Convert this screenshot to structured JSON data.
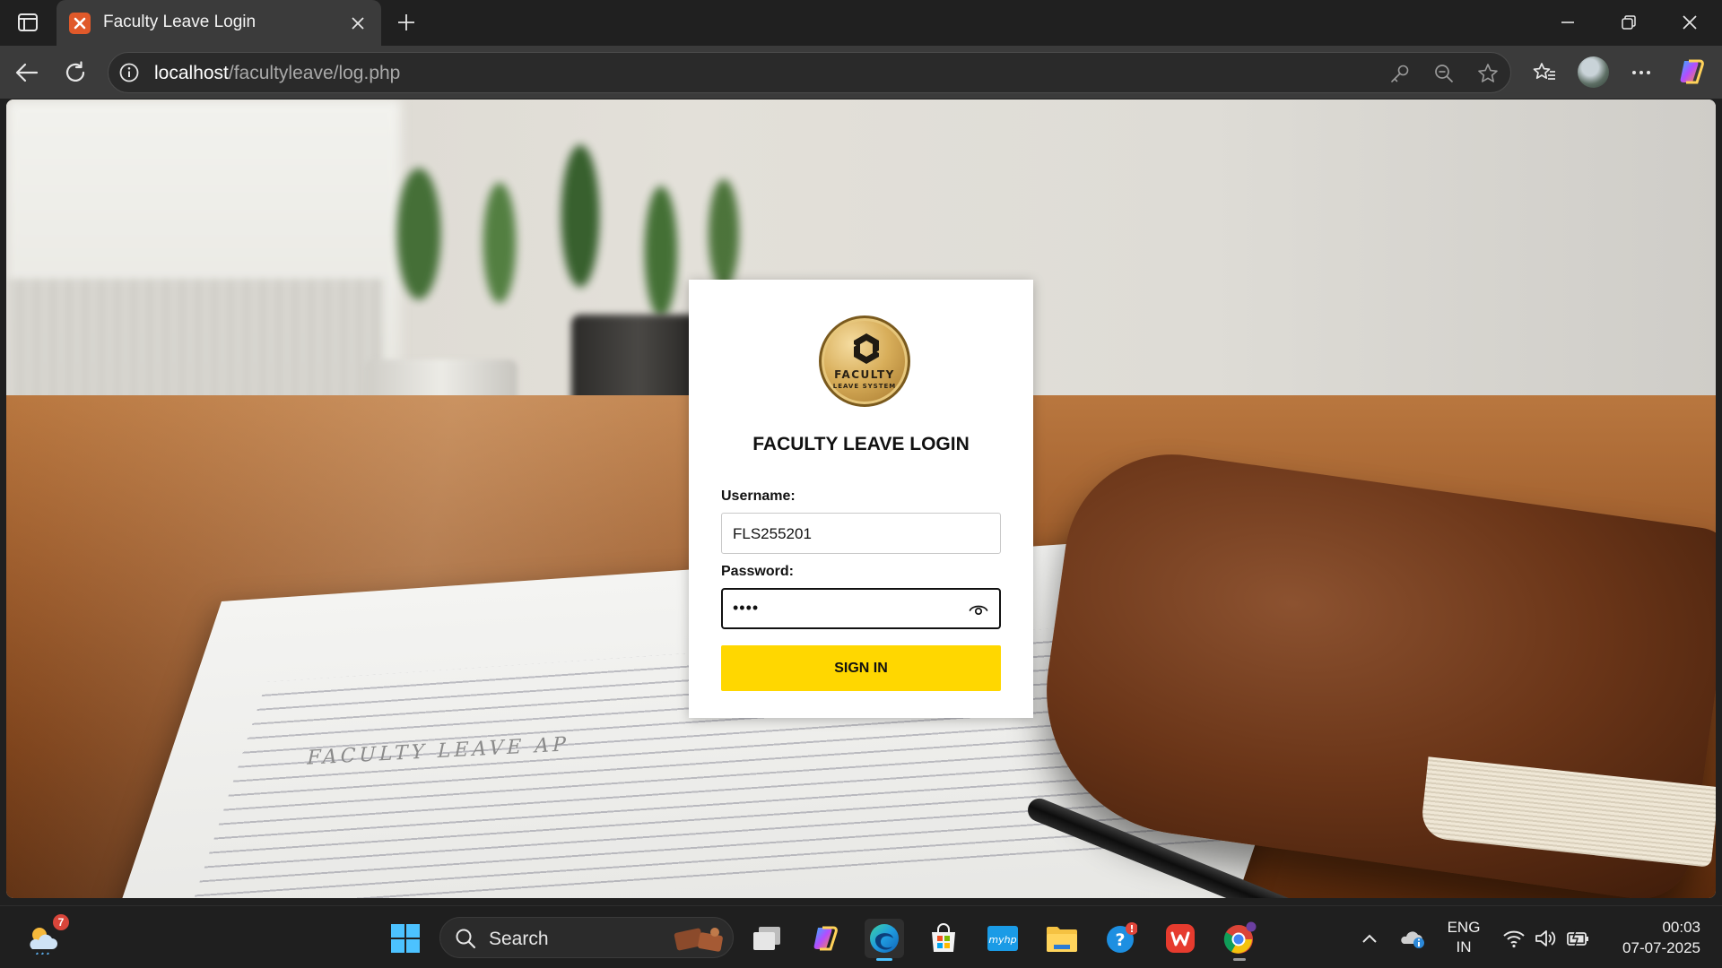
{
  "browser": {
    "tab_title": "Faculty Leave Login",
    "url_host": "localhost",
    "url_path": "/facultyleave/log.php"
  },
  "login": {
    "logo_text_main": "FACULTY",
    "logo_text_sub": "LEAVE SYSTEM",
    "title": "FACULTY LEAVE LOGIN",
    "username_label": "Username:",
    "username_value": "FLS255201",
    "password_label": "Password:",
    "password_masked": "••••",
    "signin_label": "SIGN IN"
  },
  "background": {
    "paper_heading": "FACULTY LEAVE AP"
  },
  "taskbar": {
    "weather_badge": "7",
    "search_label": "Search",
    "language_line1": "ENG",
    "language_line2": "IN",
    "time": "00:03",
    "date": "07-07-2025"
  },
  "colors": {
    "signin_button": "#ffd700",
    "tab_favicon": "#e0592a",
    "active_indicator": "#4cc2ff"
  }
}
